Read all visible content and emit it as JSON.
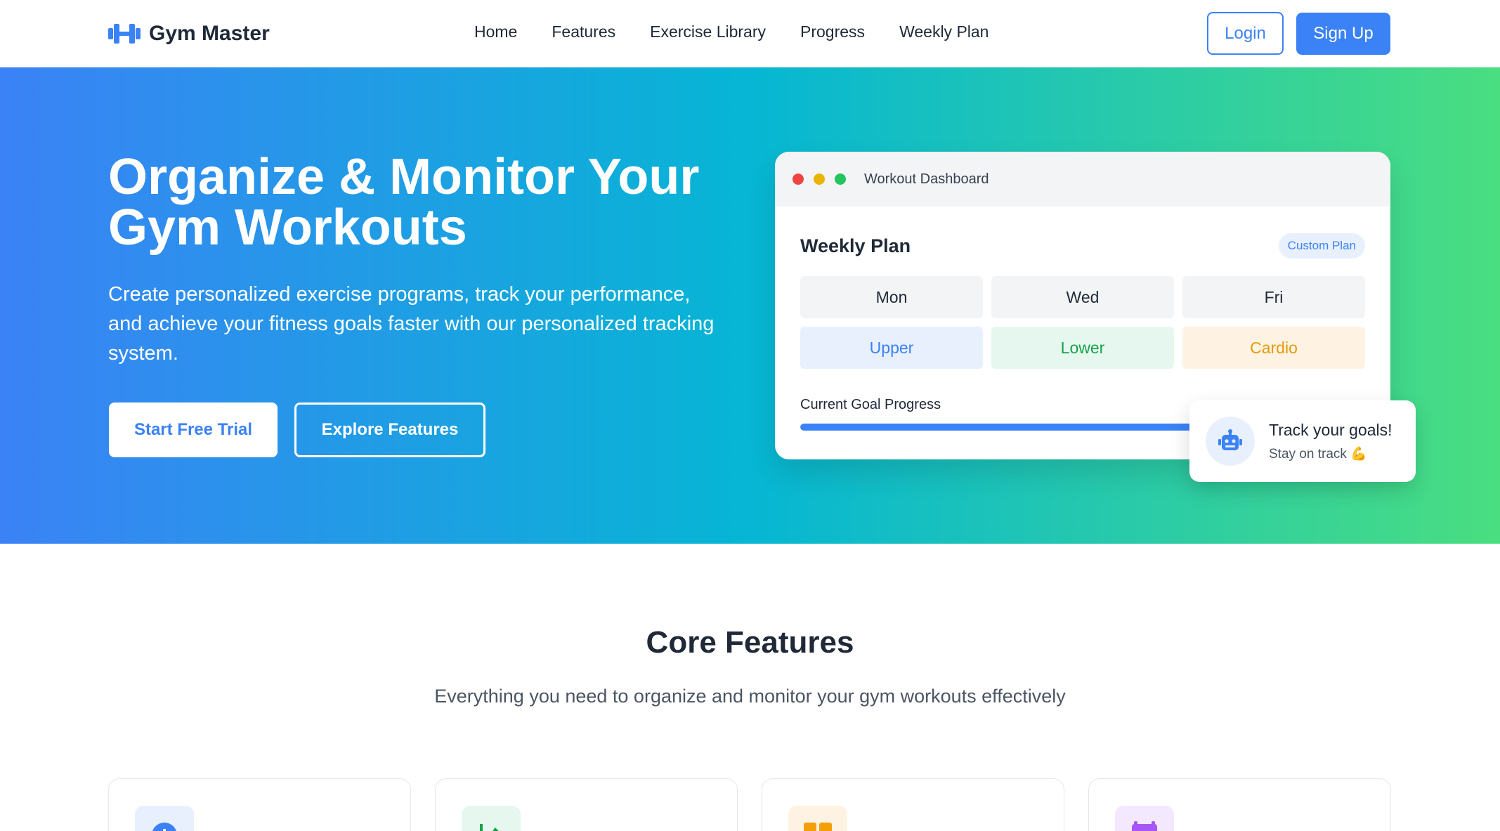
{
  "brand": {
    "name": "Gym Master",
    "icon": "dumbbell-icon",
    "color": "#3b82f6"
  },
  "nav": {
    "links": [
      "Home",
      "Features",
      "Exercise Library",
      "Progress",
      "Weekly Plan"
    ]
  },
  "auth": {
    "login": "Login",
    "signup": "Sign Up"
  },
  "hero": {
    "title": "Organize & Monitor Your Gym Workouts",
    "subtitle": "Create personalized exercise programs, track your performance, and achieve your fitness goals faster with our personalized tracking system.",
    "cta_primary": "Start Free Trial",
    "cta_secondary": "Explore Features",
    "gradient": [
      "#3b82f6",
      "#06b6d4",
      "#4ade80"
    ]
  },
  "dashboard": {
    "window_title": "Workout Dashboard",
    "window_dots": [
      "#ef4444",
      "#eab308",
      "#22c55e"
    ],
    "plan_title": "Weekly Plan",
    "plan_badge": "Custom Plan",
    "days": [
      "Mon",
      "Wed",
      "Fri"
    ],
    "workouts": [
      "Upper",
      "Lower",
      "Cardio"
    ],
    "progress_label": "Current Goal Progress",
    "progress_percent": 0.75
  },
  "tooltip": {
    "title": "Track your goals!",
    "subtitle": "Stay on track 💪",
    "icon": "robot-icon"
  },
  "features": {
    "title": "Core Features",
    "subtitle": "Everything you need to organize and monitor your gym workouts effectively",
    "cards": [
      {
        "icon": "plus-circle-icon",
        "bg": "#e8f0fe",
        "color": "#3b82f6"
      },
      {
        "icon": "chart-icon",
        "bg": "#e6f7ef",
        "color": "#16a34a"
      },
      {
        "icon": "book-icon",
        "bg": "#fef3e2",
        "color": "#f59e0b"
      },
      {
        "icon": "calendar-icon",
        "bg": "#f3e8ff",
        "color": "#a855f7"
      }
    ]
  }
}
